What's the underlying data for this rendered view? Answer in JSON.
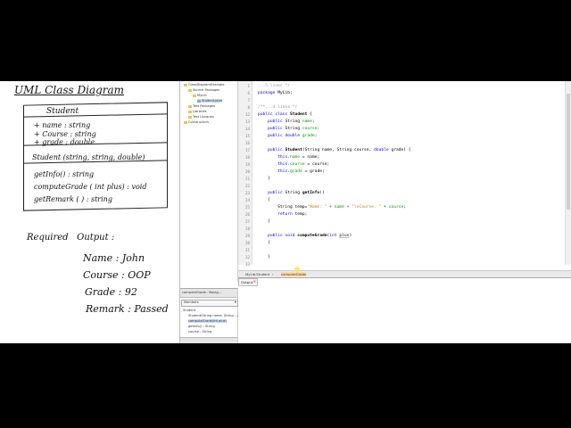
{
  "board": {
    "title": "UML Class Diagram",
    "class_name": "Student",
    "attributes": [
      "+ name : string",
      "+ Course : string",
      "+ grade : double"
    ],
    "constructor": "Student (string, string, double)",
    "methods": [
      "getInfo() : string",
      "computeGrade ( int plus) : void",
      "getRemark ( ) : string"
    ],
    "required_label": "Required   Output :",
    "outputs": [
      "Name : John",
      "Course : OOP",
      "Grade : 92",
      "Remark : Passed"
    ]
  },
  "tree": {
    "items": [
      {
        "label": "ClassDiagramExample",
        "depth": 0
      },
      {
        "label": "Source Packages",
        "depth": 1
      },
      {
        "label": "MyLib",
        "depth": 2
      },
      {
        "label": "Student.java",
        "depth": 3,
        "selected": true
      },
      {
        "label": "Test Packages",
        "depth": 1
      },
      {
        "label": "Libraries",
        "depth": 1
      },
      {
        "label": "Test Libraries",
        "depth": 1
      },
      {
        "label": "Constructors",
        "depth": 0
      }
    ]
  },
  "navigator": {
    "tab_label": "computeGrade - Navig...",
    "combo_value": "Members",
    "items": [
      "Student",
      "Student(String name, String ...)",
      "computeGrade(int plus)",
      "getInfo() : String",
      "course : String"
    ]
  },
  "editor": {
    "lines": [
      {
        "n": "1",
        "html": "<span class=\"cm\">...5 lines */</span>"
      },
      {
        "n": "6",
        "html": "<span class=\"kw\">package</span> MyLib;"
      },
      {
        "n": "7",
        "html": ""
      },
      {
        "n": "8",
        "html": "<span class=\"cm\">/**...4 lines */</span>"
      },
      {
        "n": "12",
        "html": "<span class=\"kw\">public class</span> <span class=\"b\">Student</span> {"
      },
      {
        "n": "13",
        "html": "    <span class=\"kw\">public</span> String <span class=\"fld\">name</span>;"
      },
      {
        "n": "14",
        "html": "    <span class=\"kw\">public</span> String <span class=\"fld\">course</span>;"
      },
      {
        "n": "15",
        "html": "    <span class=\"kw\">public double</span> <span class=\"fld\">grade</span>;"
      },
      {
        "n": "16",
        "html": ""
      },
      {
        "n": "17",
        "html": "    <span class=\"kw\">public</span> <span class=\"b\">Student</span>(String name, String course, <span class=\"kw\">double</span> grade) {"
      },
      {
        "n": "18",
        "html": "        <span class=\"kw\">this</span>.<span class=\"fld\">name</span> = name;"
      },
      {
        "n": "19",
        "html": "        <span class=\"kw\">this</span>.<span class=\"fld\">course</span> = course;"
      },
      {
        "n": "20",
        "html": "        <span class=\"kw\">this</span>.<span class=\"fld\">grade</span> = grade;"
      },
      {
        "n": "21",
        "html": "    }"
      },
      {
        "n": "22",
        "html": ""
      },
      {
        "n": "23",
        "html": "    <span class=\"kw\">public</span> String <span class=\"b\">getInfo</span>()"
      },
      {
        "n": "24",
        "html": "    {"
      },
      {
        "n": "25",
        "html": "        String temp=<span class=\"str\">\"Name: \"</span> + <span class=\"fld\">name</span> + <span class=\"str\">\"\\nCourse: \"</span> + <span class=\"fld\">course</span>;"
      },
      {
        "n": "26",
        "html": "        <span class=\"kw\">return</span> temp;"
      },
      {
        "n": "27",
        "html": "    }"
      },
      {
        "n": "28",
        "html": ""
      },
      {
        "n": "29",
        "html": "    <span class=\"kw\">public void</span> <span class=\"b\">computeGrade</span>(<span class=\"kw\">int</span> <span class=\"ul\">plus</span>)"
      },
      {
        "n": "30",
        "html": "    {"
      },
      {
        "n": "31",
        "html": ""
      },
      {
        "n": "32",
        "html": "    }"
      },
      {
        "n": "33",
        "html": ""
      }
    ]
  },
  "breadcrumb": [
    "MyLib.Student",
    "computeGrade"
  ],
  "output": {
    "tab_label": "Output"
  }
}
